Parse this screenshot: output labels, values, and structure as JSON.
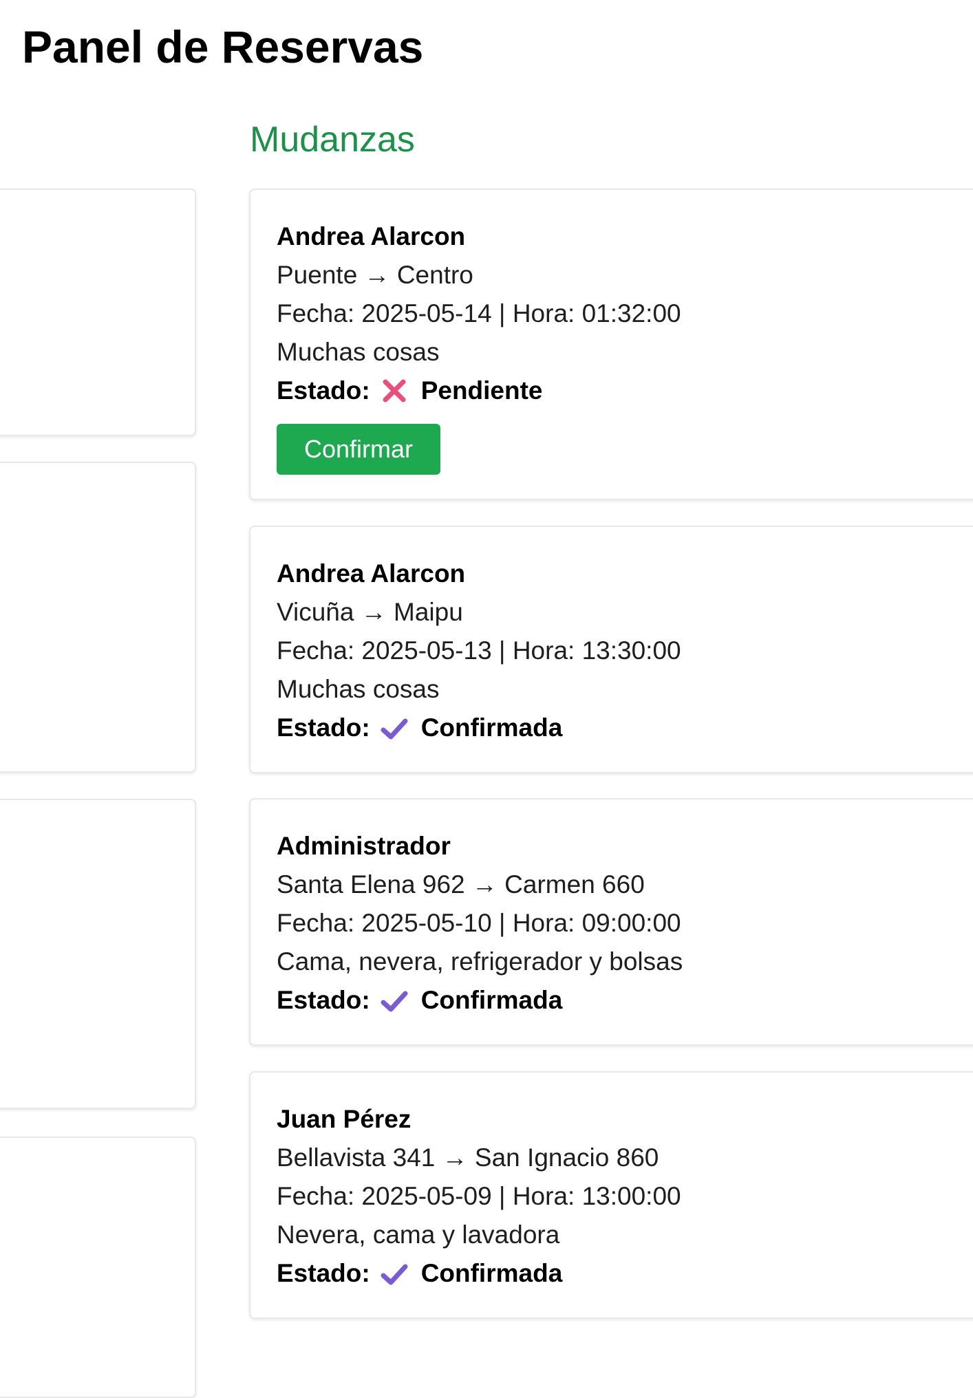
{
  "page_title": "Panel de Reservas",
  "section_title": "Mudanzas",
  "colors": {
    "section_title": "#1f8f4c",
    "confirm_button": "#1ea84f",
    "pending_icon": "#e8507c",
    "confirmed_icon": "#7b5bd1"
  },
  "reservations": [
    {
      "name": "Andrea Alarcon",
      "route": "Puente → Centro",
      "datetime": "Fecha: 2025-05-14 | Hora: 01:32:00",
      "items": "Muchas cosas",
      "status_label": "Estado:",
      "status": "Pendiente",
      "status_icon": "cross-icon",
      "action_label": "Confirmar"
    },
    {
      "name": "Andrea Alarcon",
      "route": "Vicuña → Maipu",
      "datetime": "Fecha: 2025-05-13 | Hora: 13:30:00",
      "items": "Muchas cosas",
      "status_label": "Estado:",
      "status": "Confirmada",
      "status_icon": "check-icon"
    },
    {
      "name": "Administrador",
      "route": "Santa Elena 962 → Carmen 660",
      "datetime": "Fecha: 2025-05-10 | Hora: 09:00:00",
      "items": "Cama, nevera, refrigerador y bolsas",
      "status_label": "Estado:",
      "status": "Confirmada",
      "status_icon": "check-icon"
    },
    {
      "name": "Juan Pérez",
      "route": "Bellavista 341 → San Ignacio 860",
      "datetime": "Fecha: 2025-05-09 | Hora: 13:00:00",
      "items": "Nevera, cama y lavadora",
      "status_label": "Estado:",
      "status": "Confirmada",
      "status_icon": "check-icon"
    }
  ]
}
